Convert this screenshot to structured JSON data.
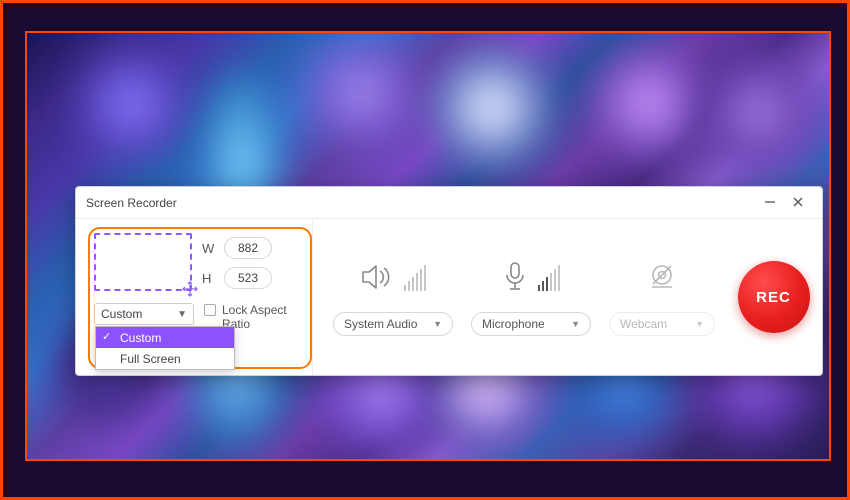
{
  "window": {
    "title": "Screen Recorder"
  },
  "capture": {
    "width_label": "W",
    "height_label": "H",
    "width_value": "882",
    "height_value": "523",
    "mode_selected": "Custom",
    "lock_label": "Lock Aspect Ratio",
    "dropdown": {
      "item_custom": "Custom",
      "item_fullscreen": "Full Screen"
    }
  },
  "sources": {
    "audio_label": "System Audio",
    "mic_label": "Microphone",
    "webcam_label": "Webcam"
  },
  "rec": {
    "label": "REC"
  }
}
